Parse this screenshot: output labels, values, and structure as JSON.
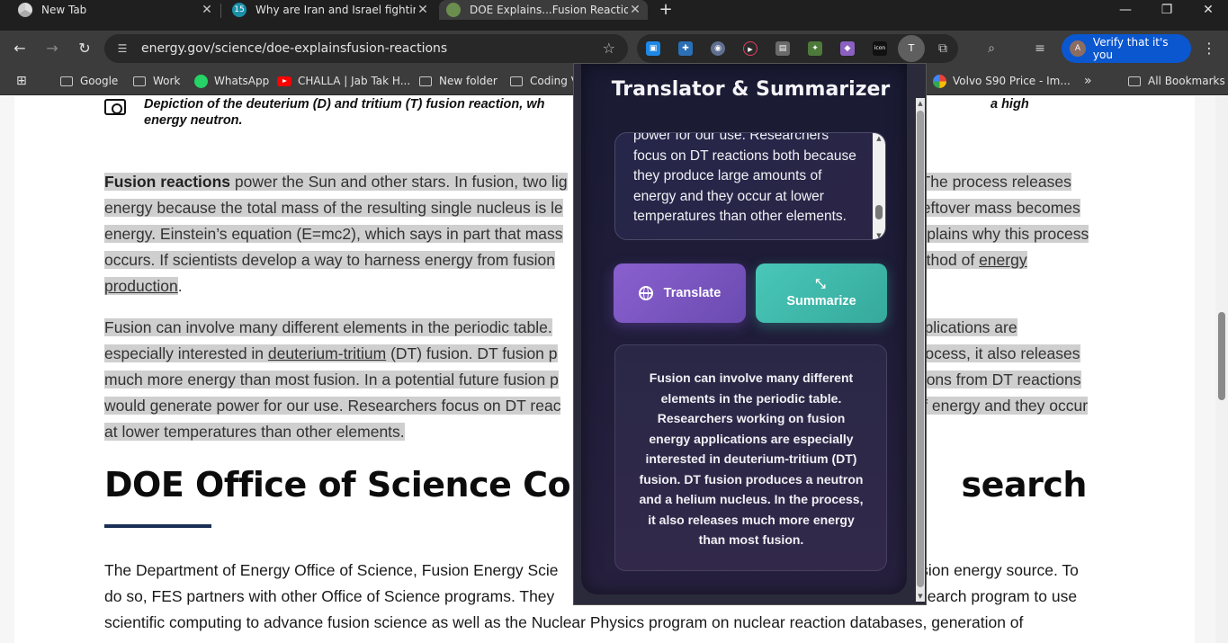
{
  "tabs": [
    {
      "title": "New Tab",
      "favicon": "chrome-icon",
      "active": false
    },
    {
      "title": "Why are Iran and Israel fighting",
      "favicon": "news-icon",
      "active": false
    },
    {
      "title": "DOE Explains...Fusion Reactions",
      "favicon": "doe-seal-icon",
      "active": true
    }
  ],
  "window_controls": {
    "minimize": "—",
    "restore": "❐",
    "close": "✕"
  },
  "toolbar": {
    "url": "energy.gov/science/doe-explainsfusion-reactions",
    "extension_t_label": "T",
    "verify_label": "Verify that it's you",
    "avatar_initial": "A"
  },
  "bookmarks": {
    "items": [
      "Google",
      "Work",
      "WhatsApp",
      "CHALLA | Jab Tak H...",
      "New folder",
      "Coding V"
    ],
    "right_items": [
      "Volvo S90 Price - Im..."
    ],
    "overflow": "»",
    "all_bookmarks": "All Bookmarks"
  },
  "article": {
    "caption": "Depiction of the deuterium (D) and tritium (T) fusion reaction, wh                                                                                                                           a high energy neutron.",
    "p1": {
      "lead": "Fusion reactions",
      "line1_a": " power the Sun and other stars. In fusion, two lig",
      "line1_b": "The process releases",
      "line2_a": "energy because the total mass of the resulting single nucleus is le",
      "line2_b": "eftover mass becomes",
      "line3_a": "energy. Einstein’s equation (E=mc2), which says in part that mass",
      "line3_b": "xplains why this process",
      "line4_a": "occurs. If scientists develop a way to harness energy from fusion",
      "line4_b": "ethod of",
      "link1": "energy",
      "link2": "production",
      "end": "."
    },
    "p2": {
      "line1_a": "Fusion can involve many different elements in the periodic table.",
      "line1_b": "pplications are",
      "line2_a": "especially interested in",
      "link": "deuterium-tritium",
      "line2_b": " (DT) fusion. DT fusion p",
      "line2_c": "rocess, it also releases",
      "line3_a": "much more energy than most fusion. In a potential future fusion p",
      "line3_b": "rons from DT reactions",
      "line4_a": "would generate power for our use. Researchers focus on DT reac",
      "line4_b": "of energy and they occur",
      "line5": "at lower temperatures than other elements."
    },
    "h2_a": "DOE Office of Science Contr",
    "h2_b": "search",
    "p3": {
      "line1_a": "The Department of Energy Office of Science, Fusion Energy Scie",
      "line1_b": "fusion energy source. To",
      "line2_a": "do so, FES partners with other Office of Science programs. They",
      "line2_b": "esearch program to use",
      "line3": "scientific computing to advance fusion science as well as the Nuclear Physics program on nuclear reaction databases, generation of"
    }
  },
  "popup": {
    "title": "Translator & Summarizer",
    "input_text": "power for our use. Researchers focus on DT reactions both because they produce large amounts of energy and they occur at lower temperatures than other elements.",
    "translate_label": "Translate",
    "summarize_label": "Summarize",
    "result_text": "Fusion can involve many different elements in the periodic table. Researchers working on fusion energy applications are especially interested in deuterium-tritium (DT) fusion. DT fusion produces a neutron and a helium nucleus. In the process, it also releases much more energy than most fusion."
  },
  "colors": {
    "verify_button": "#0b57d0",
    "translate_button": "#7a57c2",
    "summarize_button": "#40b8aa",
    "highlight": "#cfcfcf",
    "heading_rule": "#1a2e54"
  }
}
